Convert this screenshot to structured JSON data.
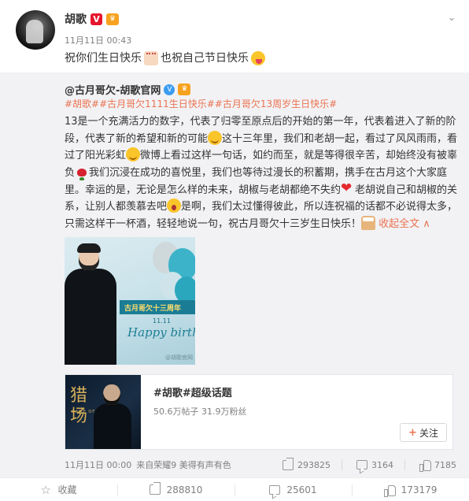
{
  "post": {
    "author": "胡歌",
    "v_badge": "V",
    "vip_badge": "♛",
    "time": "11月11日 00:43",
    "text_part1": "祝你们生日快乐",
    "text_part2": "也祝自己节日快乐",
    "more_icon": "chevron-down-icon"
  },
  "repost": {
    "author": "@古月哥欠-胡歌官网",
    "hashtags": [
      "#胡歌#",
      "#古月哥欠1111生日快乐#",
      "#古月哥欠13周岁生日快乐#"
    ],
    "body": {
      "s1": "13是一个充满活力的数字，代表了归零至原点后的开始的第一年，代表着进入了新的阶段，代表了新的希望和新的可能",
      "s2": "这十三年里，我们和老胡一起，看过了风风雨雨，看过了阳光彩虹",
      "s3": "微博上看过这样一句话，如约而至，就是等得很辛苦，却始终没有被辜负",
      "s4": "我们沉浸在成功的喜悦里，我们也等待过漫长的积蓄期，携手在古月这个大家庭里。幸运的是，无论是怎么样的未来，胡椒与老胡都绝不失约",
      "s5": "老胡说自己和胡椒的关系，让别人都羡慕去吧",
      "s6": "是啊，我们太过懂得彼此，所以连祝福的话都不必说得太多，只需这样干一杯酒，轻轻地说一句，祝古月哥欠十三岁生日快乐！",
      "collapse": "收起全文 ∧"
    },
    "photo": {
      "banner": "古月哥欠十三周年",
      "date": "11.11",
      "happy": "Happy birthd",
      "watermark": "@胡歌官网"
    },
    "topic": {
      "title": "#胡歌#超级话题",
      "stats": "50.6万帖子 31.9万粉丝",
      "follow_label": "关注",
      "cover_title": "猎场",
      "cover_tiny": "GAME OF HUNTING"
    },
    "footer": {
      "time": "11月11日 00:00",
      "source_prefix": "来自",
      "source": "荣耀9 美得有声有色",
      "shares": "293825",
      "comments": "3164",
      "likes": "7185"
    }
  },
  "bottom_bar": {
    "favorite": "收藏",
    "share": "288810",
    "comment": "25601",
    "like": "173179"
  },
  "colors": {
    "link_orange": "#eb7350",
    "v_red": "#e6162d",
    "v_blue": "#3b9cf0",
    "repost_bg": "#f2f2f5"
  }
}
